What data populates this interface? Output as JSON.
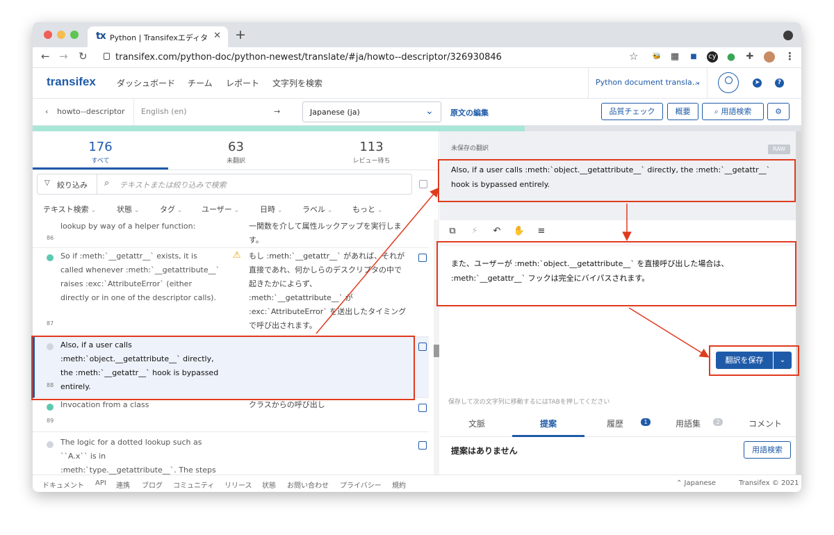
{
  "browser": {
    "tab_title": "Python | Transifexエディタ",
    "tab_favicon": "tx",
    "url": "transifex.com/python-doc/python-newest/translate/#ja/howto--descriptor/326930846",
    "icons": [
      "back-icon",
      "forward-icon",
      "reload-icon",
      "lock-icon",
      "star-icon",
      "extension-icon",
      "profile-icon",
      "menu-icon"
    ],
    "extensions": [
      "🐝",
      "▦",
      "■",
      "cy",
      "●",
      "✚"
    ]
  },
  "header": {
    "logo": "transifex",
    "nav": [
      "ダッシュボード",
      "チーム",
      "レポート",
      "文字列を検索"
    ],
    "project": "Python document transla…"
  },
  "subheader": {
    "breadcrumb": "howto--descriptor",
    "source_lang": "English (en)",
    "arrow": "→",
    "target_lang": "Japanese (ja)",
    "edit_source": "原文の編集",
    "buttons": [
      "品質チェック",
      "概要",
      "用語検索"
    ]
  },
  "progress": {
    "translated_fraction": 0.64
  },
  "counts": [
    {
      "num": "176",
      "label": "すべて"
    },
    {
      "num": "63",
      "label": "未翻訳"
    },
    {
      "num": "113",
      "label": "レビュー待ち"
    }
  ],
  "filter": {
    "button": "絞り込み",
    "placeholder": "テキストまたは絞り込みで検索",
    "facets": [
      "テキスト検索",
      "状態",
      "タグ",
      "ユーザー",
      "日時",
      "ラベル",
      "もっと"
    ]
  },
  "rows": [
    {
      "num": "86",
      "source": "lookup by way of a helper function:",
      "target": "一関数を介して属性ルックアップを実行します。",
      "status": "none"
    },
    {
      "num": "87",
      "source": "So if :meth:`__getattr__` exists, it is called whenever :meth:`__getattribute__` raises :exc:`AttributeError` (either directly or in one of the descriptor calls).",
      "target": "もし :meth:`__getattr__` があれば、それが直接であれ、何かしらのデスクリプタの中で起きたかによらず、 :meth:`__getattribute__` が :exc:`AttributeError` を送出したタイミングで呼び出されます。",
      "status": "reviewed"
    },
    {
      "num": "88",
      "source": "Also, if a user calls :meth:`object.__getattribute__` directly, the :meth:`__getattr__` hook is bypassed entirely.",
      "target": "",
      "status": "untranslated"
    },
    {
      "num": "89",
      "source": "Invocation from a class",
      "target": "クラスからの呼び出し",
      "status": "reviewed"
    },
    {
      "num": "",
      "source": "The logic for a dotted lookup such as ``A.x`` is in :meth:`type.__getattribute__`. The steps are similar to those for",
      "target": "",
      "status": "untranslated"
    }
  ],
  "editor": {
    "unsaved_label": "未保存の翻訳",
    "raw_label": "RAW",
    "source_text": "Also, if a user calls :meth:`object.__getattribute__` directly, the :meth:`__getattr__` hook is bypassed entirely.",
    "tools": [
      "copy-icon",
      "bolt-icon",
      "undo-icon",
      "hand-icon",
      "search-list-icon"
    ],
    "translation_text": "また、ユーザーが :meth:`object.__getattribute__` を直接呼び出した場合は、 :meth:`__getattr__` フックは完全にバイパスされます。",
    "save_label": "翻訳を保存",
    "hint": "保存して次の文字列に移動するにはTABを押してください"
  },
  "info_tabs": [
    {
      "label": "文脈",
      "badge": ""
    },
    {
      "label": "提案",
      "badge": ""
    },
    {
      "label": "履歴",
      "badge": "1"
    },
    {
      "label": "用語集",
      "badge": "2"
    },
    {
      "label": "コメント",
      "badge": ""
    }
  ],
  "suggestions": {
    "empty_text": "提案はありません",
    "glossary_button": "用語検索"
  },
  "footer": {
    "links": [
      "ドキュメント",
      "API",
      "連携",
      "ブログ",
      "コミュニティ",
      "リリース",
      "状態",
      "お問い合わせ",
      "プライバシー",
      "規約"
    ],
    "language": "⌃ Japanese",
    "copyright": "Transifex © 2021"
  },
  "colors": {
    "brand": "#1e5aa8",
    "annotation": "#e03a1e",
    "reviewed": "#5cc9b0",
    "untranslated": "#d2d5dd",
    "warning": "#e3a008"
  }
}
